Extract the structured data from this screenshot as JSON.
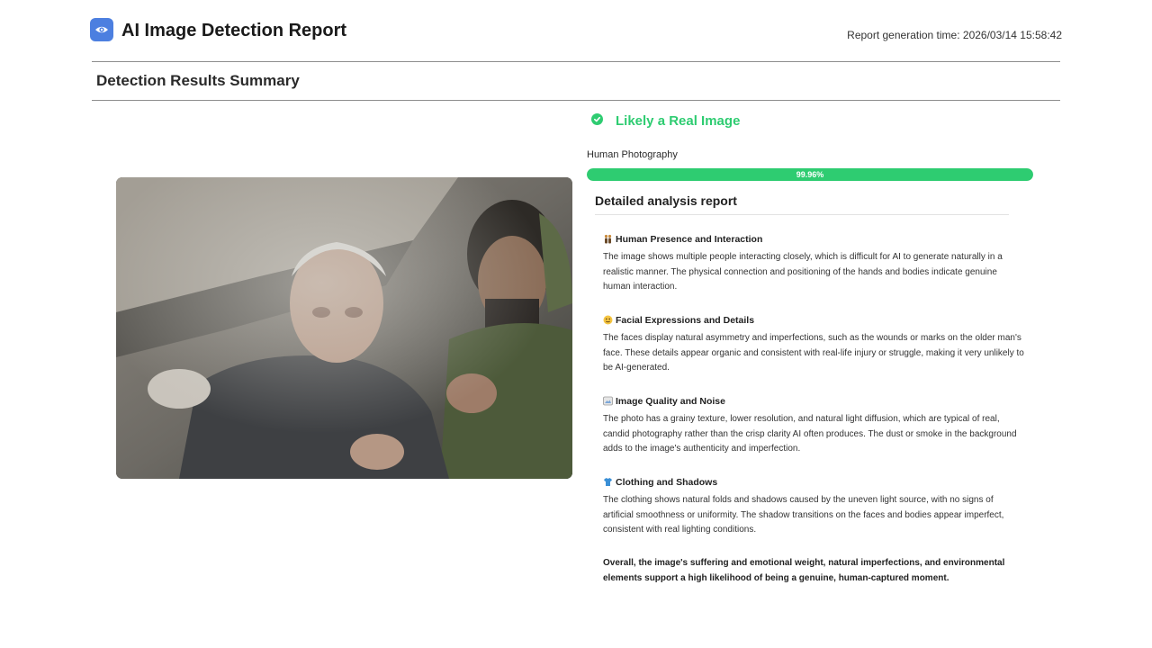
{
  "header": {
    "title": "AI Image Detection Report",
    "report_time": "Report generation time: 2026/03/14 15:58:42",
    "logo_icon": "eye-icon",
    "logo_color": "#4c7fe0"
  },
  "summary": {
    "section_title": "Detection Results Summary"
  },
  "photo": {
    "description_icon": "analyzed-photo"
  },
  "result": {
    "verdict": "Likely a Real Image",
    "verdict_icon": "check-circle-icon",
    "verdict_color": "#2ecc71",
    "category": "Human Photography",
    "confidence_text": "99.96%",
    "confidence_value": 0.9996
  },
  "analysis": {
    "title": "Detailed analysis report",
    "items": [
      {
        "icon": "people-icon",
        "title": "Human Presence and Interaction",
        "body": "The image shows multiple people interacting closely, which is difficult for AI to generate naturally in a realistic manner. The physical connection and positioning of the hands and bodies indicate genuine human interaction."
      },
      {
        "icon": "face-icon",
        "title": "Facial Expressions and Details",
        "body": "The faces display natural asymmetry and imperfections, such as the wounds or marks on the older man's face. These details appear organic and consistent with real-life injury or struggle, making it very unlikely to be AI-generated."
      },
      {
        "icon": "image-quality-icon",
        "title": "Image Quality and Noise",
        "body": "The photo has a grainy texture, lower resolution, and natural light diffusion, which are typical of real, candid photography rather than the crisp clarity AI often produces. The dust or smoke in the background adds to the image's authenticity and imperfection."
      },
      {
        "icon": "shirt-icon",
        "title": "Clothing and Shadows",
        "body": "The clothing shows natural folds and shadows caused by the uneven light source, with no signs of artificial smoothness or uniformity. The shadow transitions on the faces and bodies appear imperfect, consistent with real lighting conditions."
      }
    ],
    "conclusion": "Overall, the image's suffering and emotional weight, natural imperfections, and environmental elements support a high likelihood of being a genuine, human-captured moment."
  }
}
